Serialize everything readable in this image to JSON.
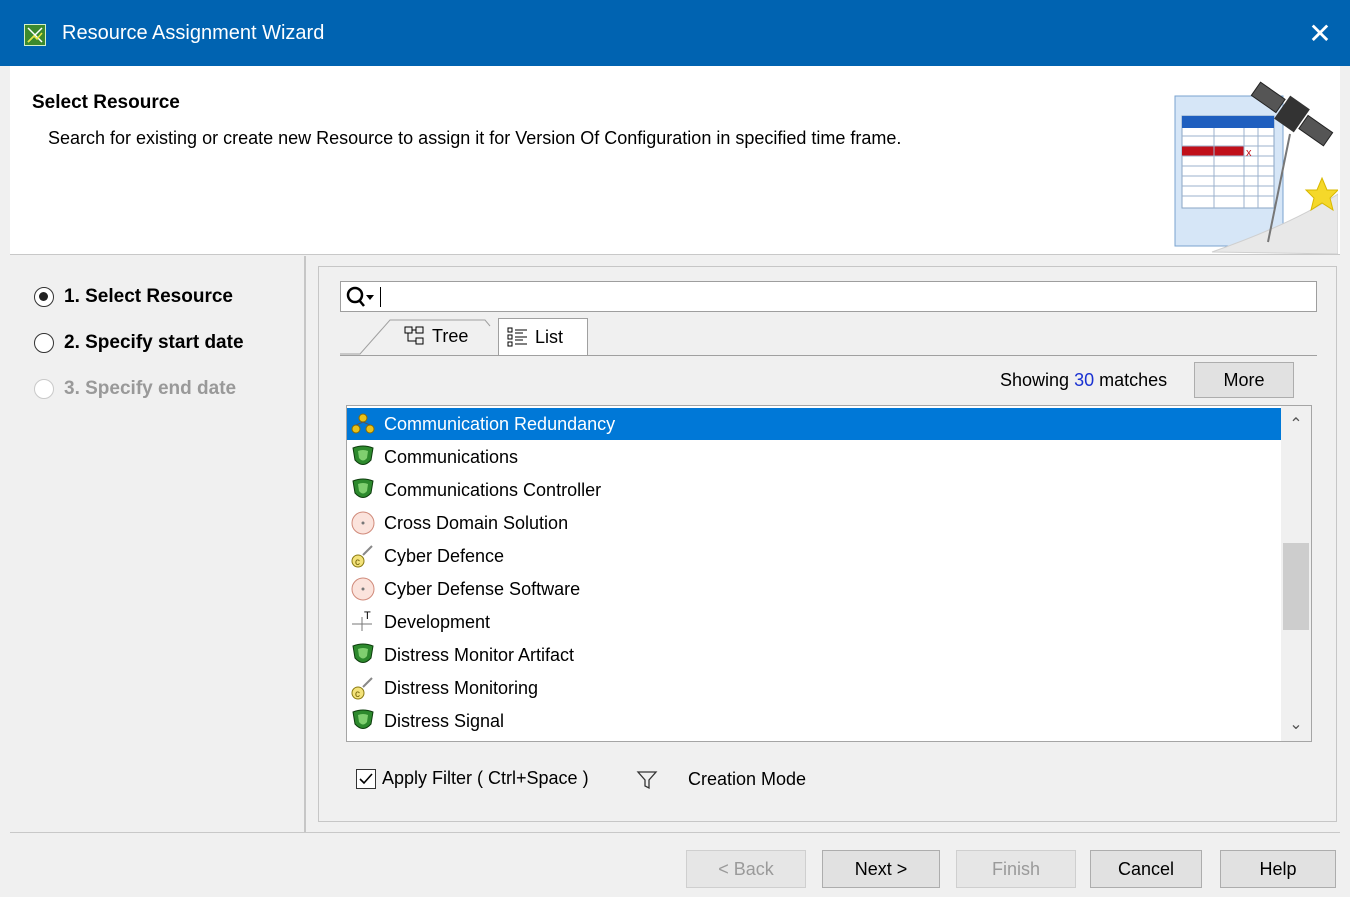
{
  "window": {
    "title": "Resource Assignment Wizard",
    "close_glyph": "✕"
  },
  "header": {
    "title": "Select Resource",
    "description": "Search for existing or create new Resource to assign it for Version Of Configuration in specified time frame."
  },
  "steps": [
    {
      "label": "1. Select Resource",
      "selected": true,
      "enabled": true
    },
    {
      "label": "2. Specify start date",
      "selected": false,
      "enabled": true
    },
    {
      "label": "3. Specify end date",
      "selected": false,
      "enabled": false
    }
  ],
  "search": {
    "value": "",
    "placeholder": ""
  },
  "tabs": [
    {
      "label": "Tree",
      "icon": "tree-icon",
      "active": false
    },
    {
      "label": "List",
      "icon": "list-icon",
      "active": true
    }
  ],
  "results": {
    "prefix": "Showing",
    "count": "30",
    "suffix": "matches",
    "more_label": "More"
  },
  "list_items": [
    {
      "label": "Communication Redundancy",
      "icon": "capability-icon",
      "selected": true
    },
    {
      "label": "Communications",
      "icon": "resource-artifact-icon"
    },
    {
      "label": "Communications Controller",
      "icon": "resource-artifact-icon"
    },
    {
      "label": "Cross Domain Solution",
      "icon": "software-icon"
    },
    {
      "label": "Cyber Defence",
      "icon": "capability-configuration-icon"
    },
    {
      "label": "Cyber Defense Software",
      "icon": "software-icon"
    },
    {
      "label": "Development",
      "icon": "project-icon"
    },
    {
      "label": "Distress Monitor Artifact",
      "icon": "resource-artifact-icon"
    },
    {
      "label": "Distress Monitoring",
      "icon": "capability-configuration-icon"
    },
    {
      "label": "Distress Signal",
      "icon": "resource-artifact-icon"
    }
  ],
  "filter": {
    "label": "Apply Filter ( Ctrl+Space )",
    "checked": true,
    "creation_mode_label": "Creation Mode"
  },
  "buttons": {
    "back": "< Back",
    "next": "Next >",
    "finish": "Finish",
    "cancel": "Cancel",
    "help": "Help"
  },
  "colors": {
    "titlebar": "#0063b1",
    "selection": "#0078d7",
    "count": "#1a32d2"
  }
}
